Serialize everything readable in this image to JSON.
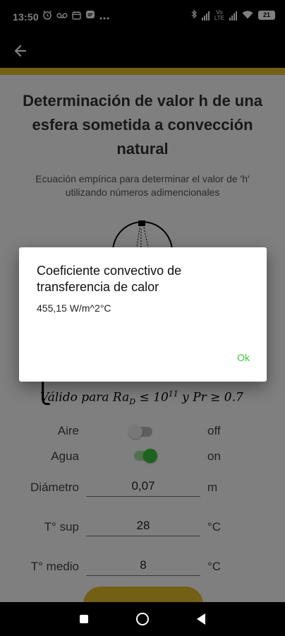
{
  "status_bar": {
    "time": "13:50",
    "battery": "21"
  },
  "page": {
    "title": "Determinación de valor h de una esfera sometida a convección natural",
    "subtitle": "Ecuación empírica para determinar el valor de 'h' utilizando números adimencionales"
  },
  "formula": {
    "text_a": "Válido para Ra",
    "sub_a": "D",
    "text_b": " ≤ 10",
    "sup_b": "11",
    "text_c": "  y Pr ≥ 0.7"
  },
  "fluids": [
    {
      "label": "Aire",
      "state": "off",
      "checked": false
    },
    {
      "label": "Agua",
      "state": "on",
      "checked": true
    }
  ],
  "inputs": [
    {
      "label": "Diámetro",
      "value": "0,07",
      "unit": "m"
    },
    {
      "label": "T° sup",
      "value": "28",
      "unit": "°C"
    },
    {
      "label": "T° medio",
      "value": "8",
      "unit": "°C"
    }
  ],
  "dialog": {
    "title": "Coeficiente convectivo de transferencia de calor",
    "message": "455,15 W/m^2°C",
    "ok_label": "Ok"
  },
  "colors": {
    "accent": "#e8c028",
    "switch_on": "#3ac63a",
    "dialog_button": "#3ac63a"
  },
  "icons": [
    "back-arrow-icon",
    "alarm-icon",
    "voicemail-icon",
    "calendar-icon",
    "chat-icon",
    "bluetooth-icon",
    "signal-icon",
    "wifi-icon",
    "battery-icon"
  ]
}
